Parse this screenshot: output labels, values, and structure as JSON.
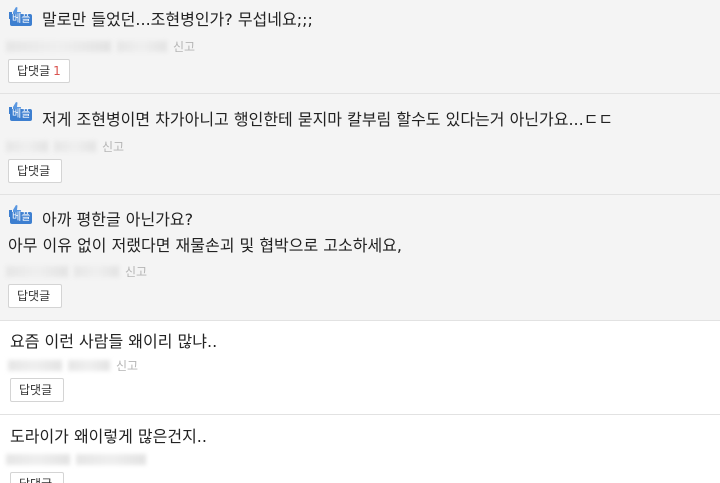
{
  "best_label": "베플",
  "reply_label": "답댓글",
  "report_label": "신고",
  "comments": [
    {
      "best": true,
      "lines": [
        "말로만 들었던...조현병인가? 무섭네요;;;"
      ],
      "reply_count": "1"
    },
    {
      "best": true,
      "lines": [
        "저게 조현병이면 차가아니고 행인한테 묻지마 칼부림 할수도 있다는거 아닌가요...ㄷㄷ"
      ],
      "reply_count": ""
    },
    {
      "best": true,
      "lines": [
        "아까 평한글 아닌가요?",
        "아무 이유 없이 저랬다면 재물손괴 및 협박으로 고소하세요,"
      ],
      "reply_count": ""
    },
    {
      "best": false,
      "lines": [
        "요즘 이런 사람들 왜이리 많냐.."
      ],
      "reply_count": ""
    },
    {
      "best": false,
      "lines": [
        "도라이가 왜이렇게 많은건지.."
      ],
      "reply_count": ""
    }
  ],
  "colors": {
    "best_badge": "#3d7fd0",
    "best_bg": "#f4f4f4",
    "reply_count": "#d9534f"
  }
}
